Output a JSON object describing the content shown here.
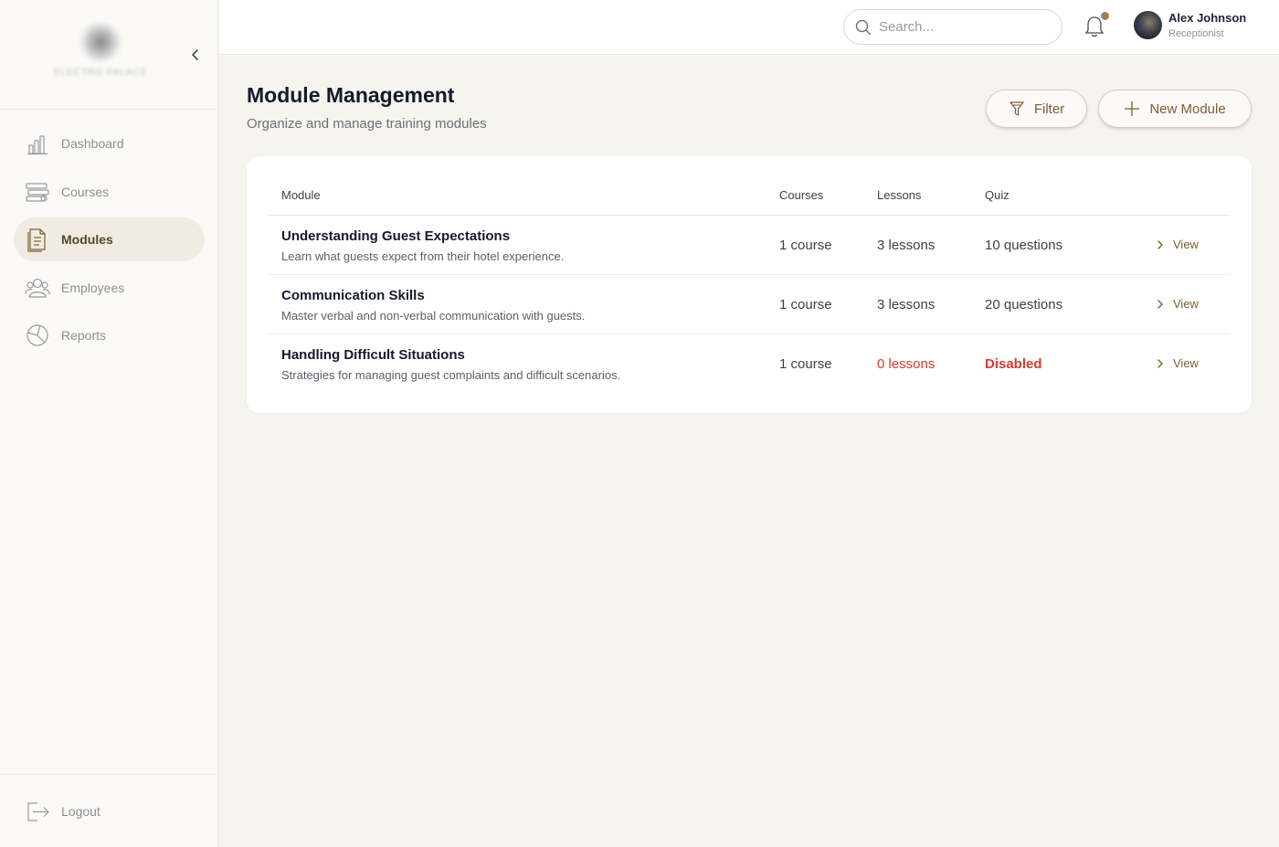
{
  "brand": {
    "logo_text": "ELECTRO PALACE"
  },
  "sidebar": {
    "items": [
      {
        "label": "Dashboard",
        "icon": "bar-chart-icon"
      },
      {
        "label": "Courses",
        "icon": "books-icon"
      },
      {
        "label": "Modules",
        "icon": "document-icon",
        "active": true
      },
      {
        "label": "Employees",
        "icon": "users-icon"
      },
      {
        "label": "Reports",
        "icon": "pie-chart-icon"
      }
    ],
    "logout_label": "Logout"
  },
  "topbar": {
    "search_placeholder": "Search...",
    "notification_dot_color": "#a0814f",
    "user": {
      "name": "Alex Johnson",
      "role": "Receptionist"
    }
  },
  "page": {
    "title": "Module Management",
    "subtitle": "Organize and manage training modules",
    "filter_label": "Filter",
    "new_module_label": "New Module"
  },
  "table": {
    "columns": [
      "Module",
      "Courses",
      "Lessons",
      "Quiz"
    ],
    "rows": [
      {
        "title": "Understanding Guest Expectations",
        "description": "Learn what guests expect from their hotel experience.",
        "courses": "1 course",
        "lessons": "3 lessons",
        "quiz": "10 questions",
        "action": "View"
      },
      {
        "title": "Communication Skills",
        "description": "Master verbal and non-verbal communication with guests.",
        "courses": "1 course",
        "lessons": "3 lessons",
        "quiz": "20 questions",
        "action": "View"
      },
      {
        "title": "Handling Difficult Situations",
        "description": "Strategies for managing guest complaints and difficult scenarios.",
        "courses": "1 course",
        "lessons": "0 lessons",
        "quiz": "Disabled",
        "action": "View"
      }
    ]
  },
  "colors": {
    "accent": "#7b5e32",
    "danger": "#d83a2f",
    "background": "#f6f4ef"
  }
}
